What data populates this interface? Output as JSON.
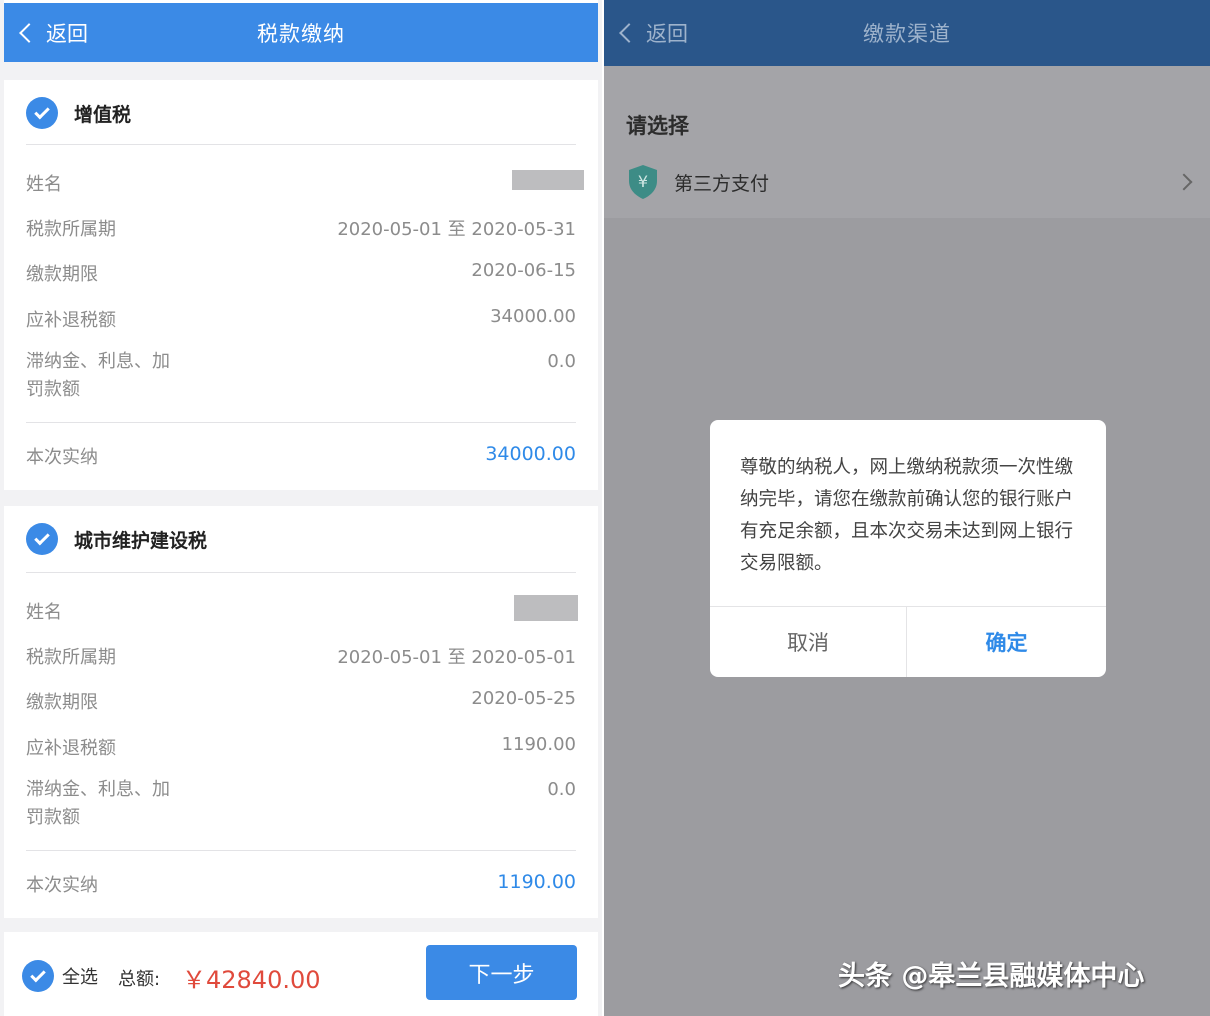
{
  "left": {
    "nav": {
      "back_label": "返回",
      "title": "税款缴纳"
    },
    "cards": [
      {
        "title": "增值税",
        "name_label": "姓名",
        "period_label": "税款所属期",
        "period_value": "2020-05-01 至 2020-05-31",
        "deadline_label": "缴款期限",
        "deadline_value": "2020-06-15",
        "tax_label": "应补退税额",
        "tax_value": "34000.00",
        "penalty_label_line1": "滞纳金、利息、加",
        "penalty_label_line2": "罚款额",
        "penalty_value": "0.0",
        "paid_label": "本次实纳",
        "paid_value": "34000.00"
      },
      {
        "title": "城市维护建设税",
        "name_label": "姓名",
        "period_label": "税款所属期",
        "period_value": "2020-05-01 至 2020-05-01",
        "deadline_label": "缴款期限",
        "deadline_value": "2020-05-25",
        "tax_label": "应补退税额",
        "tax_value": "1190.00",
        "penalty_label_line1": "滞纳金、利息、加",
        "penalty_label_line2": "罚款额",
        "penalty_value": "0.0",
        "paid_label": "本次实纳",
        "paid_value": "1190.00"
      }
    ],
    "bottom": {
      "select_all_label": "全选",
      "total_label": "总额:",
      "total_value": "￥42840.00",
      "next_label": "下一步"
    }
  },
  "right": {
    "nav": {
      "back_label": "返回",
      "title": "缴款渠道"
    },
    "choose_title": "请选择",
    "pay_option_label": "第三方支付",
    "pay_icon_glyph": "¥",
    "dialog": {
      "message": "尊敬的纳税人，网上缴纳税款须一次性缴纳完毕，请您在缴款前确认您的银行账户有充足余额，且本次交易未达到网上银行交易限额。",
      "cancel_label": "取消",
      "ok_label": "确定"
    },
    "watermark": "头条 @皋兰县融媒体中心"
  },
  "colors": {
    "primary_blue": "#3b8ae6",
    "amount_blue": "#2f8ae8",
    "total_red": "#e04a3c",
    "overlay_gray": "#9c9ca0",
    "dim_navbar": "#2a568a",
    "shield_teal": "#3d8c86"
  }
}
